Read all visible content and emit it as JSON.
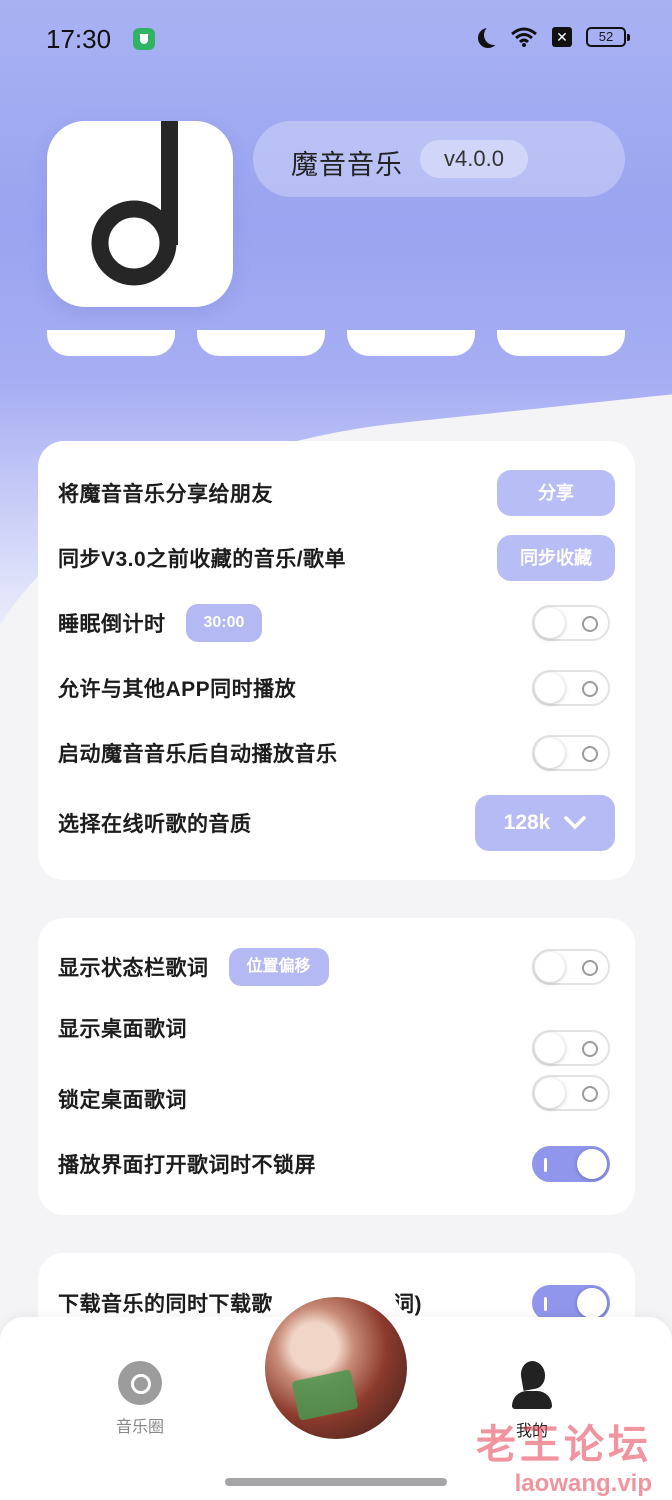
{
  "status_bar": {
    "time": "17:30",
    "battery": "52"
  },
  "header": {
    "app_name": "魔音音乐",
    "version": "v4.0.0"
  },
  "card1": {
    "share": {
      "label": "将魔音音乐分享给朋友",
      "button": "分享"
    },
    "sync": {
      "label": "同步V3.0之前收藏的音乐/歌单",
      "button": "同步收藏"
    },
    "sleep_timer": {
      "label": "睡眠倒计时",
      "chip": "30:00",
      "enabled": false
    },
    "mix_play": {
      "label": "允许与其他APP同时播放",
      "enabled": false
    },
    "autoplay": {
      "label": "启动魔音音乐后自动播放音乐",
      "enabled": false
    },
    "quality": {
      "label": "选择在线听歌的音质",
      "value": "128k"
    }
  },
  "card2": {
    "status_lyrics": {
      "label": "显示状态栏歌词",
      "chip": "位置偏移",
      "enabled": false
    },
    "desktop_lyrics": {
      "label": "显示桌面歌词",
      "enabled": false
    },
    "lock_lyrics": {
      "label": "锁定桌面歌词",
      "enabled": false
    },
    "no_lock": {
      "label": "播放界面打开歌词时不锁屏",
      "enabled": true
    }
  },
  "card3": {
    "download_lyrics": {
      "label": "下载音乐的同时下载歌",
      "tail": "词)",
      "enabled": true
    }
  },
  "bottom_nav": {
    "left_label": "音乐圈",
    "right_label": "我的"
  },
  "watermark": {
    "cn": "老王论坛",
    "url": "laowang.vip"
  },
  "colors": {
    "accent": "#8f96ec",
    "chip": "#b9bdf5",
    "toggle_on": "#8f96ec"
  }
}
